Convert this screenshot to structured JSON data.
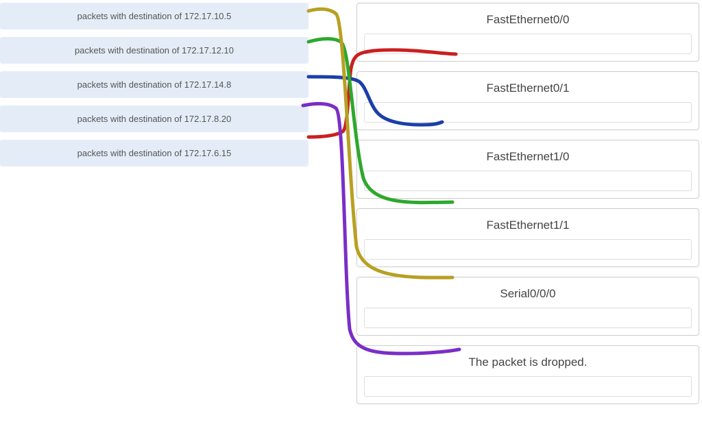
{
  "sources": [
    {
      "label": "packets with destination of 172.17.10.5"
    },
    {
      "label": "packets with destination of 172.17.12.10"
    },
    {
      "label": "packets with destination of 172.17.14.8"
    },
    {
      "label": "packets with destination of 172.17.8.20"
    },
    {
      "label": "packets with destination of 172.17.6.15"
    }
  ],
  "targets": [
    {
      "label": "FastEthernet0/0"
    },
    {
      "label": "FastEthernet0/1"
    },
    {
      "label": "FastEthernet1/0"
    },
    {
      "label": "FastEthernet1/1"
    },
    {
      "label": "Serial0/0/0"
    },
    {
      "label": "The packet is dropped."
    }
  ],
  "connections": [
    {
      "from": 0,
      "to": 3,
      "color": "yellow"
    },
    {
      "from": 1,
      "to": 2,
      "color": "green"
    },
    {
      "from": 2,
      "to": 1,
      "color": "blue"
    },
    {
      "from": 3,
      "to": 4,
      "color": "purple"
    },
    {
      "from": 4,
      "to": 0,
      "color": "red"
    }
  ]
}
